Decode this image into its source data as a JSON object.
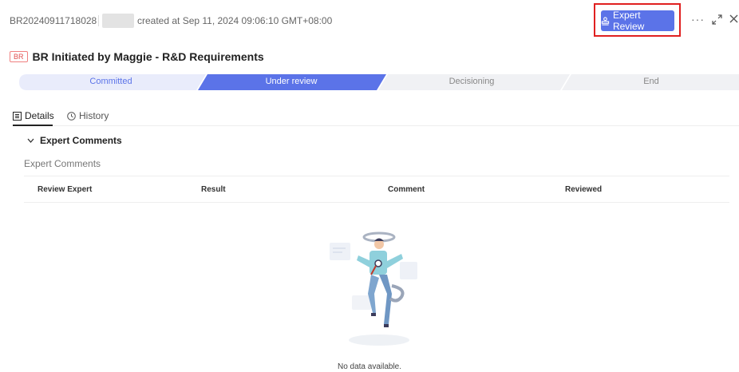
{
  "header": {
    "request_id": "BR20240911718028",
    "created_text": "created at Sep 11, 2024 09:06:10 GMT+08:00",
    "expert_review_label": "Expert Review",
    "more_label": "···"
  },
  "title": {
    "tag": "BR",
    "text": "BR Initiated by Maggie - R&D Requirements"
  },
  "steps": [
    {
      "label": "Committed",
      "state": "done"
    },
    {
      "label": "Under review",
      "state": "active"
    },
    {
      "label": "Decisioning",
      "state": "pending"
    },
    {
      "label": "End",
      "state": "pending"
    }
  ],
  "tabs": [
    {
      "label": "Details",
      "icon": "list-icon",
      "active": true
    },
    {
      "label": "History",
      "icon": "clock-icon",
      "active": false
    }
  ],
  "section": {
    "title": "Expert Comments",
    "sub_label": "Expert Comments",
    "columns": [
      "Review Expert",
      "Result",
      "Comment",
      "Reviewed"
    ],
    "rows": [],
    "empty_text": "No data available."
  },
  "colors": {
    "accent": "#5b73e8",
    "step_done": "#e9ecfb",
    "step_pending": "#f0f1f4",
    "highlight": "#e02020"
  }
}
